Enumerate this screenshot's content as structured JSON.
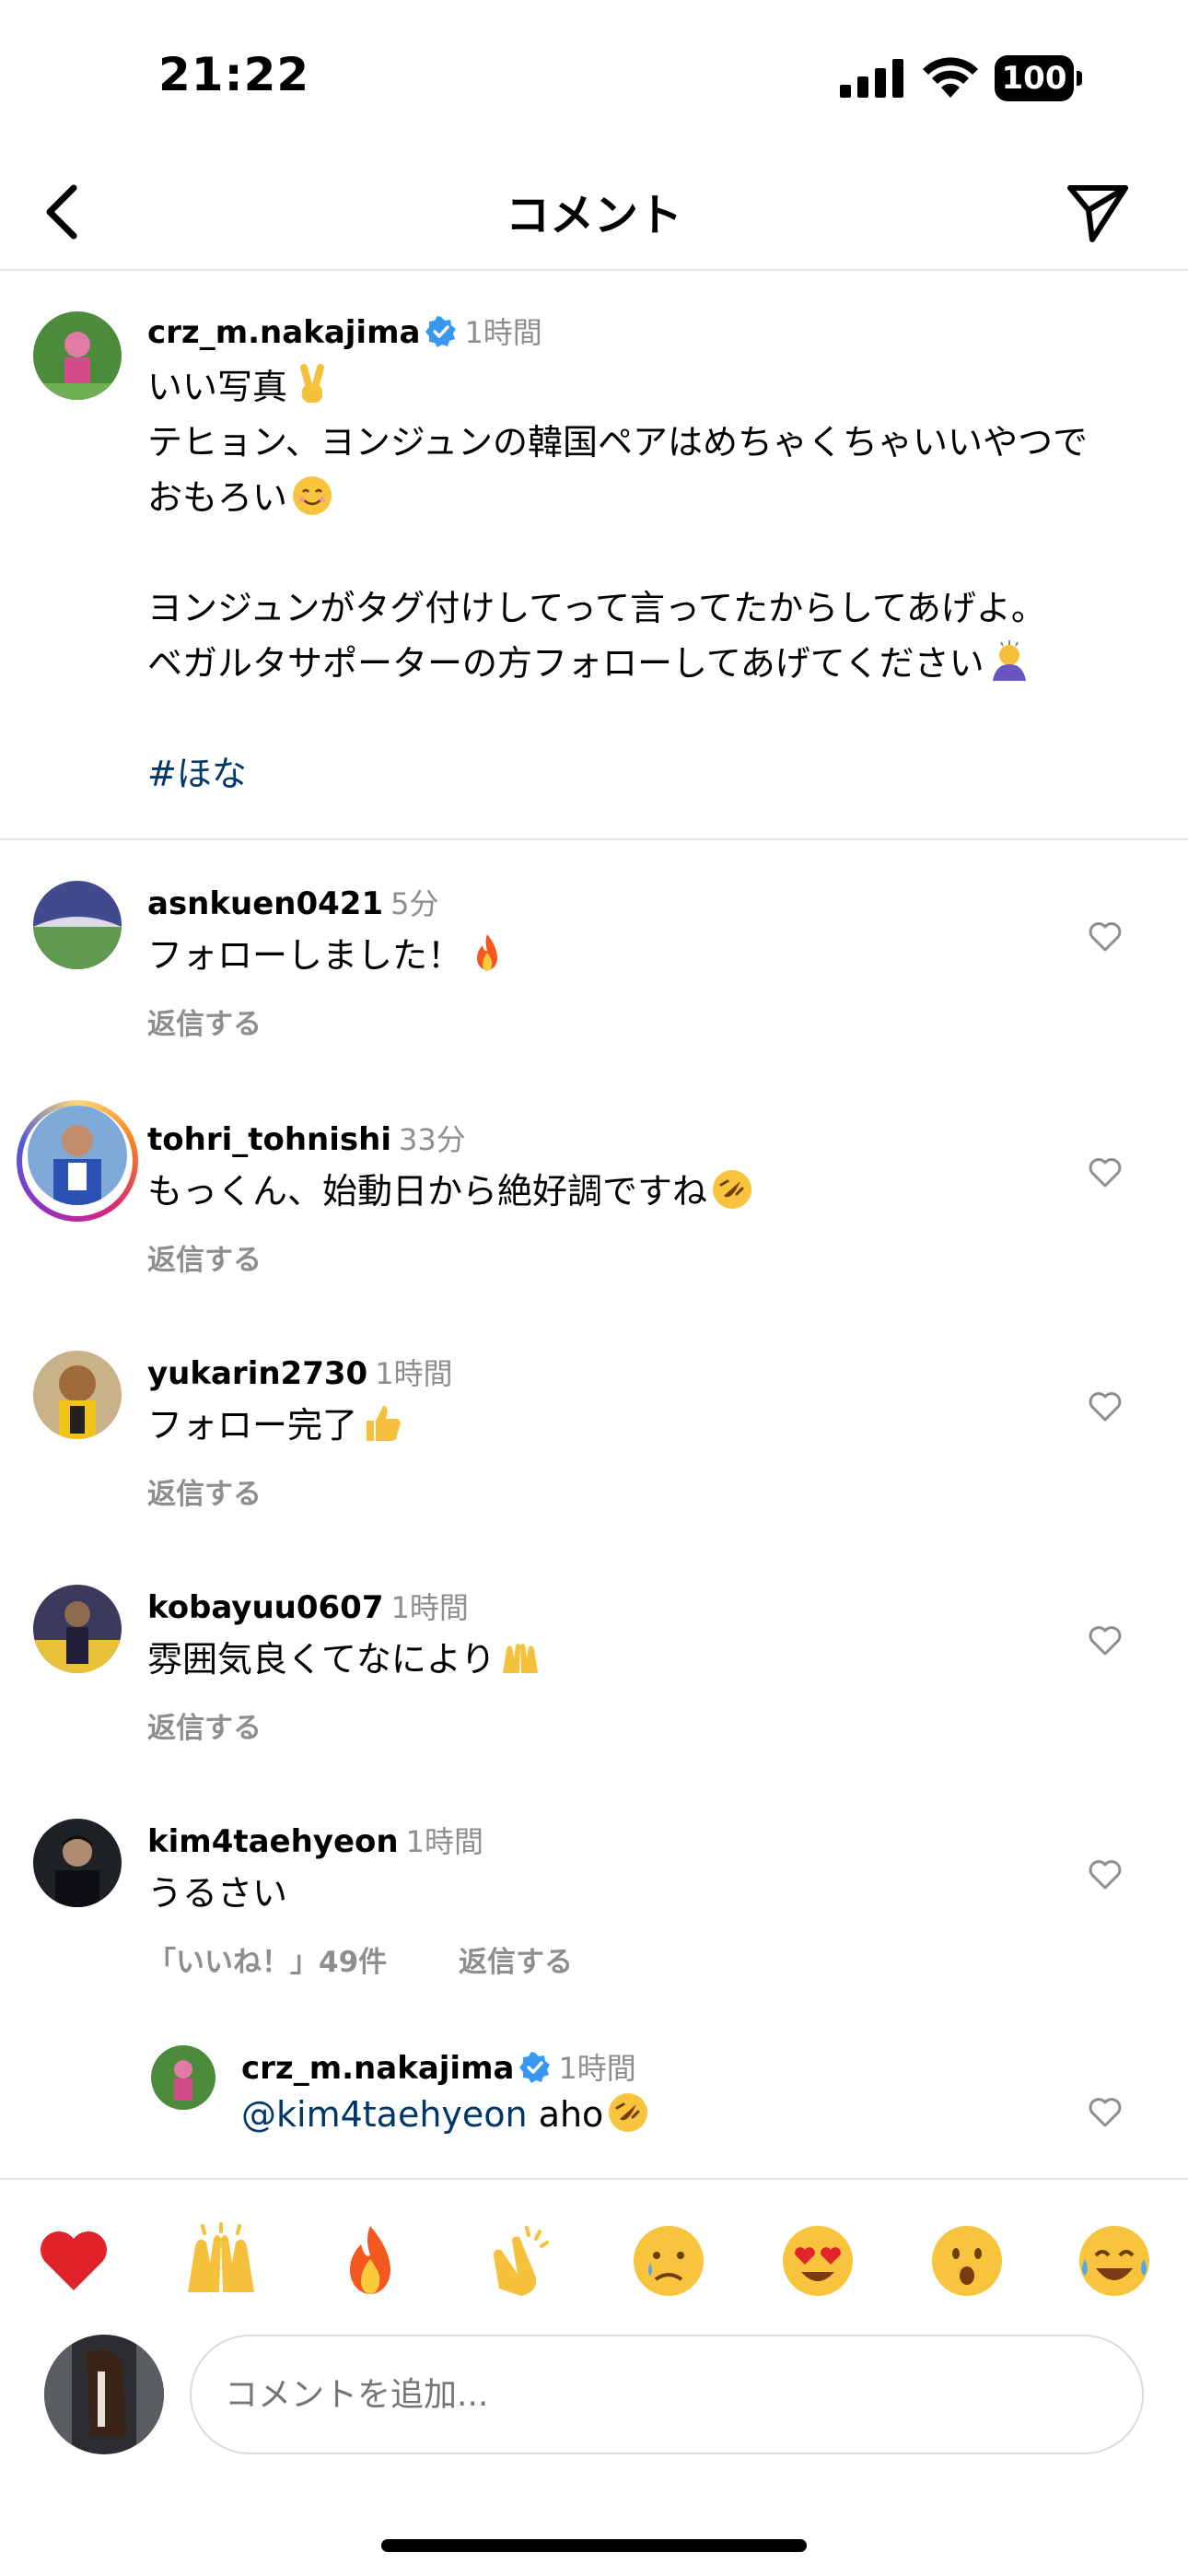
{
  "status": {
    "time": "21:22",
    "battery": "100"
  },
  "nav": {
    "title": "コメント"
  },
  "caption": {
    "username": "crz_m.nakajima",
    "time": "1時間",
    "lines": [
      "いい写真",
      "テヒョン、ヨンジュンの韓国ペアはめちゃくちゃいいやつで",
      "おもろい",
      "",
      "ヨンジュンがタグ付けしてって言ってたからしてあげよ。",
      "ベガルタサポーターの方フォローしてあげてください"
    ],
    "hashtag": "#ほな"
  },
  "comments": [
    {
      "username": "asnkuen0421",
      "time": "5分",
      "text": "フォローしました！",
      "reply": "返信する"
    },
    {
      "username": "tohri_tohnishi",
      "time": "33分",
      "text": "もっくん、始動日から絶好調ですね",
      "reply": "返信する"
    },
    {
      "username": "yukarin2730",
      "time": "1時間",
      "text": "フォロー完了",
      "reply": "返信する"
    },
    {
      "username": "kobayuu0607",
      "time": "1時間",
      "text": "雰囲気良くてなにより",
      "reply": "返信する"
    },
    {
      "username": "kim4taehyeon",
      "time": "1時間",
      "text": "うるさい",
      "likes": "「いいね！」49件",
      "reply": "返信する"
    }
  ],
  "thread_reply": {
    "username": "crz_m.nakajima",
    "time": "1時間",
    "mention": "@kim4taehyeon",
    "text": " aho"
  },
  "emoji_bar": [
    "heart",
    "raised-hands",
    "fire",
    "clapping-hands",
    "crying-face",
    "heart-eyes",
    "surprised-face",
    "tears-of-joy"
  ],
  "input": {
    "placeholder": "コメントを追加..."
  },
  "colors": {
    "link": "#00376b",
    "muted": "#8e8e8e",
    "verified": "#3897f0"
  }
}
